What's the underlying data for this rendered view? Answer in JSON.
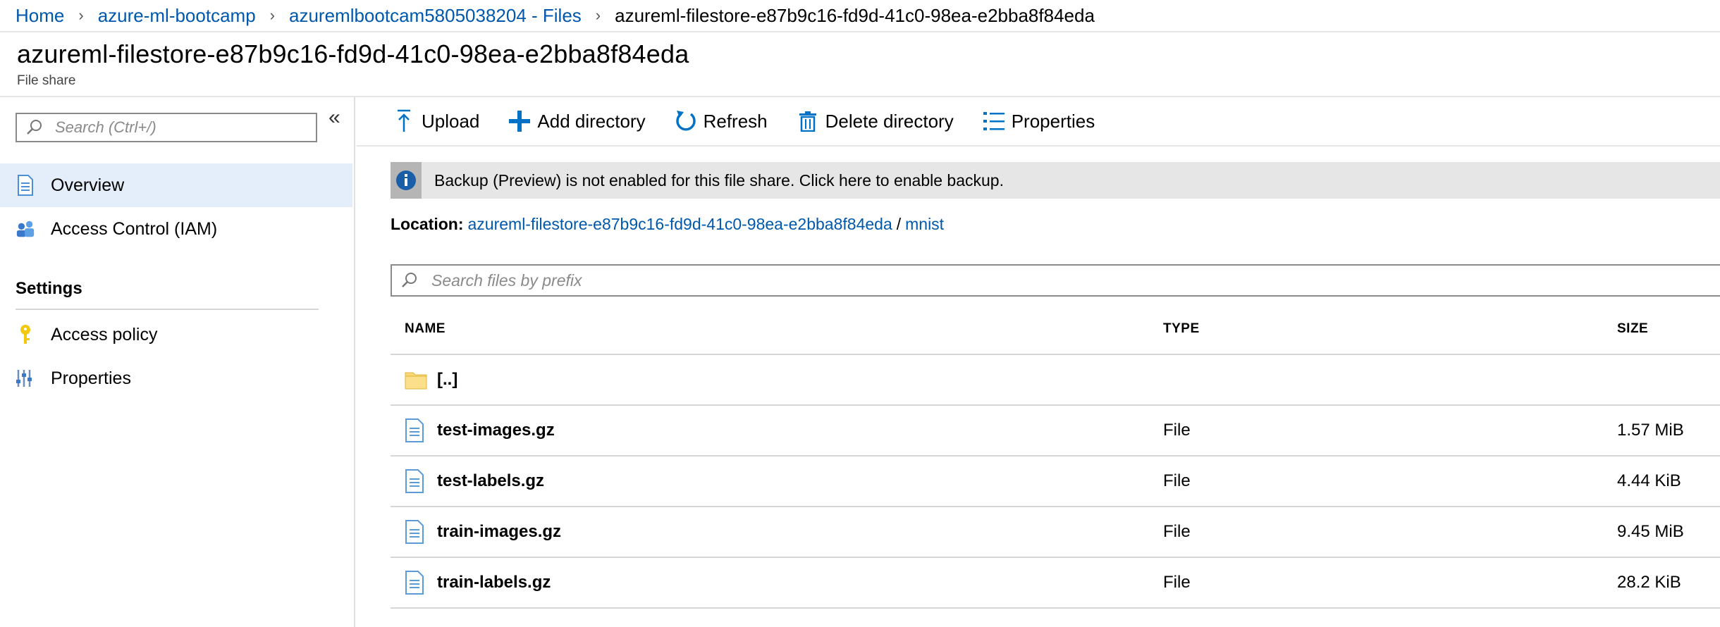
{
  "breadcrumb": {
    "items": [
      "Home",
      "azure-ml-bootcamp",
      "azuremlbootcam5805038204 - Files"
    ],
    "current": "azureml-filestore-e87b9c16-fd9d-41c0-98ea-e2bba8f84eda"
  },
  "header": {
    "title": "azureml-filestore-e87b9c16-fd9d-41c0-98ea-e2bba8f84eda",
    "subtitle": "File share"
  },
  "sidebar": {
    "search_placeholder": "Search (Ctrl+/)",
    "collapse_glyph": "«",
    "items": [
      {
        "label": "Overview",
        "icon": "document-icon",
        "active": true
      },
      {
        "label": "Access Control (IAM)",
        "icon": "people-icon",
        "active": false
      }
    ],
    "section_label": "Settings",
    "settings_items": [
      {
        "label": "Access policy",
        "icon": "key-icon"
      },
      {
        "label": "Properties",
        "icon": "sliders-icon"
      }
    ]
  },
  "toolbar": {
    "upload": "Upload",
    "add_directory": "Add directory",
    "refresh": "Refresh",
    "delete_directory": "Delete directory",
    "properties": "Properties"
  },
  "banner": {
    "text": "Backup (Preview) is not enabled for this file share. Click here to enable backup."
  },
  "location": {
    "label": "Location:",
    "share_link": "azureml-filestore-e87b9c16-fd9d-41c0-98ea-e2bba8f84eda",
    "separator": "/",
    "folder_link": "mnist"
  },
  "file_search": {
    "placeholder": "Search files by prefix"
  },
  "table": {
    "columns": [
      "NAME",
      "TYPE",
      "SIZE"
    ],
    "rows": [
      {
        "name": "[..]",
        "type": "",
        "size": "",
        "icon": "folder-icon"
      },
      {
        "name": "test-images.gz",
        "type": "File",
        "size": "1.57 MiB",
        "icon": "file-icon"
      },
      {
        "name": "test-labels.gz",
        "type": "File",
        "size": "4.44 KiB",
        "icon": "file-icon"
      },
      {
        "name": "train-images.gz",
        "type": "File",
        "size": "9.45 MiB",
        "icon": "file-icon"
      },
      {
        "name": "train-labels.gz",
        "type": "File",
        "size": "28.2 KiB",
        "icon": "file-icon"
      }
    ]
  },
  "colors": {
    "link": "#0058ad",
    "accent": "#0072c6",
    "active_nav": "#e4eefb",
    "banner_bg": "#e6e6e6"
  }
}
